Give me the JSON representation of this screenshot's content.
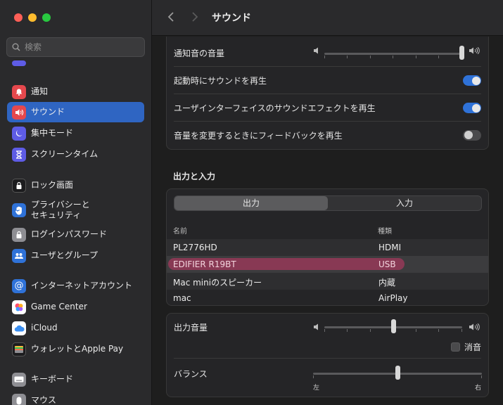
{
  "window": {
    "title": "サウンド"
  },
  "search": {
    "placeholder": "検索"
  },
  "sidebar": {
    "items": [
      {
        "label": "通知",
        "icon": "bell-icon",
        "color": "#e5484d"
      },
      {
        "label": "サウンド",
        "icon": "speaker-icon",
        "color": "#e5484d",
        "selected": true
      },
      {
        "label": "集中モード",
        "icon": "moon-icon",
        "color": "#5e5ce6"
      },
      {
        "label": "スクリーンタイム",
        "icon": "hourglass-icon",
        "color": "#5e5ce6"
      },
      {
        "label": "ロック画面",
        "icon": "lock-screen-icon",
        "color": "#1c1c1e"
      },
      {
        "label": "プライバシーと\nセキュリティ",
        "icon": "hand-icon",
        "color": "#2f72d8"
      },
      {
        "label": "ログインパスワード",
        "icon": "lock-icon",
        "color": "#8e8e93"
      },
      {
        "label": "ユーザとグループ",
        "icon": "users-icon",
        "color": "#2f72d8"
      },
      {
        "label": "インターネットアカウント",
        "icon": "at-icon",
        "color": "#2f72d8"
      },
      {
        "label": "Game Center",
        "icon": "game-center-icon",
        "color": "#ffffff"
      },
      {
        "label": "iCloud",
        "icon": "cloud-icon",
        "color": "#ffffff"
      },
      {
        "label": "ウォレットとApple Pay",
        "icon": "wallet-icon",
        "color": "#1c1c1e"
      },
      {
        "label": "キーボード",
        "icon": "keyboard-icon",
        "color": "#8e8e93"
      },
      {
        "label": "マウス",
        "icon": "mouse-icon",
        "color": "#8e8e93"
      }
    ]
  },
  "sound_effects": {
    "alert_volume_label": "通知音の音量",
    "alert_volume": 1.0,
    "startup_sound_label": "起動時にサウンドを再生",
    "startup_sound": true,
    "ui_sound_label": "ユーザインターフェイスのサウンドエフェクトを再生",
    "ui_sound": true,
    "feedback_label": "音量を変更するときにフィードバックを再生",
    "feedback": false
  },
  "output_input": {
    "section_title": "出力と入力",
    "tabs": [
      "出力",
      "入力"
    ],
    "active_tab": "出力",
    "columns": {
      "name": "名前",
      "type": "種類"
    },
    "devices": [
      {
        "name": "PL2776HD",
        "type": "HDMI"
      },
      {
        "name": "EDIFIER R19BT",
        "type": "USB",
        "selected": true
      },
      {
        "name": "Mac miniのスピーカー",
        "type": "内蔵"
      },
      {
        "name": "mac",
        "type": "AirPlay"
      }
    ]
  },
  "output_volume": {
    "label": "出力音量",
    "value": 0.5,
    "mute_label": "消音",
    "muted": false,
    "balance_label": "バランス",
    "balance": 0.5,
    "balance_left": "左",
    "balance_right": "右"
  }
}
